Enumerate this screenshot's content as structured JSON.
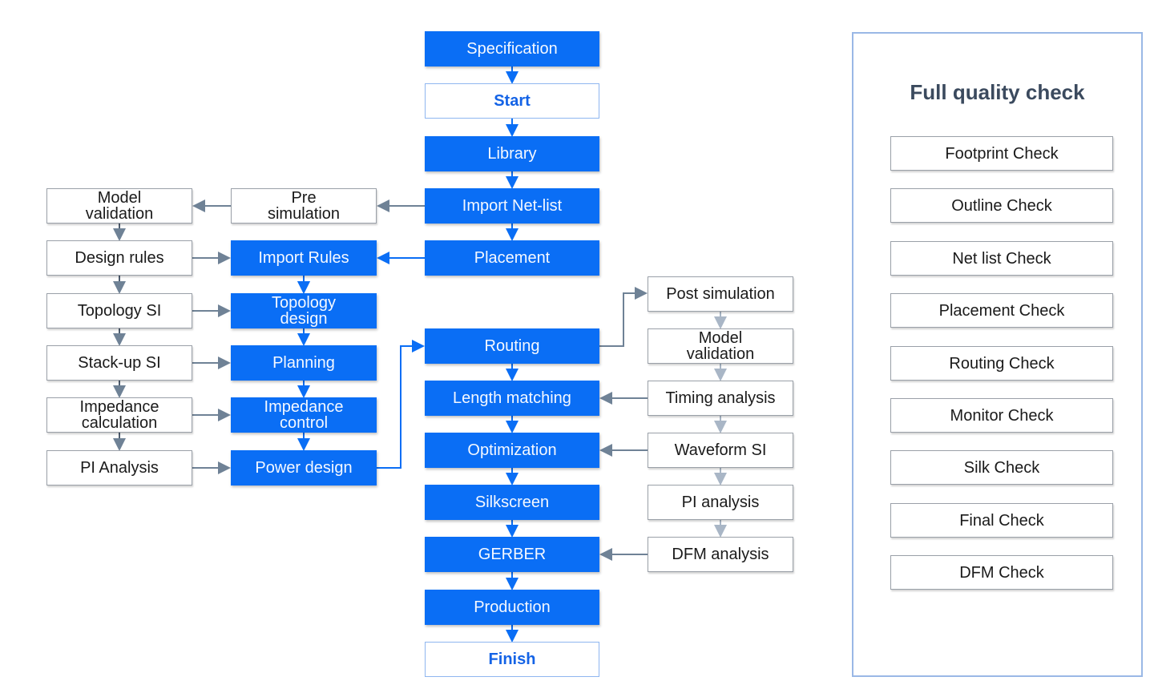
{
  "main_flow": [
    "Specification",
    "Start",
    "Library",
    "Import Net-list",
    "Placement",
    "Routing",
    "Length matching",
    "Optimization",
    "Silkscreen",
    "GERBER",
    "Production",
    "Finish"
  ],
  "pre_design_flow": [
    "Pre simulation",
    "Import Rules",
    "Topology design",
    "Planning",
    "Impedance control",
    "Power design"
  ],
  "analysis_flow": [
    "Model validation",
    "Design rules",
    "Topology SI",
    "Stack-up SI",
    "Impedance calculation",
    "PI Analysis"
  ],
  "post_layout_flow": [
    "Post simulation",
    "Model validation",
    "Timing analysis",
    "Waveform SI",
    "PI analysis",
    "DFM analysis"
  ],
  "quality_panel": {
    "title": "Full quality check",
    "checks": [
      "Footprint Check",
      "Outline Check",
      "Net list Check",
      "Placement Check",
      "Routing Check",
      "Monitor Check",
      "Silk Check",
      "Final Check",
      "DFM Check"
    ]
  },
  "colors": {
    "primary_blue": "#0a6ef5",
    "arrow_gray": "#6f8296",
    "arrow_light": "#a9b6c6",
    "panel_border": "#9ab8e6"
  }
}
